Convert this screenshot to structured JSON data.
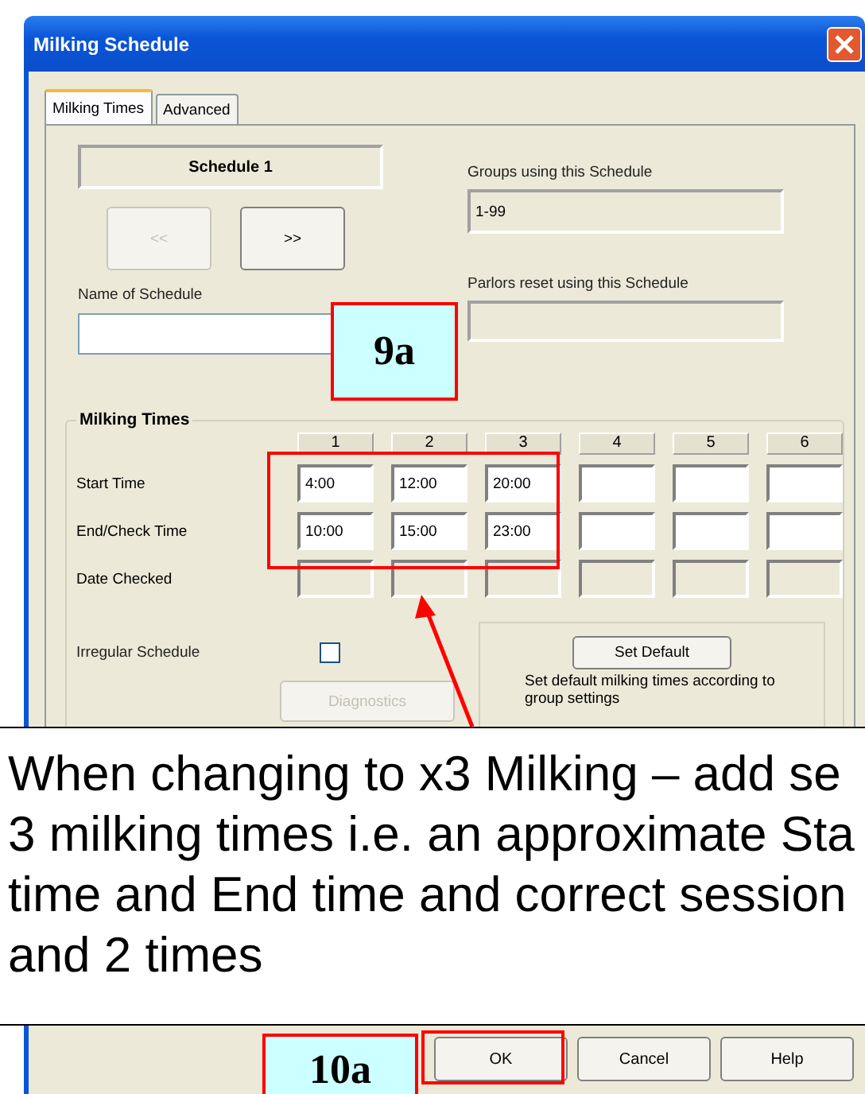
{
  "window": {
    "title": "Milking Schedule"
  },
  "tabs": [
    {
      "label": "Milking Times",
      "selected": true
    },
    {
      "label": "Advanced",
      "selected": false
    }
  ],
  "schedule": {
    "name_display": "Schedule 1",
    "prev_button": {
      "label": "<<",
      "disabled": true
    },
    "next_button": {
      "label": ">>",
      "disabled": false
    },
    "name_label": "Name of Schedule"
  },
  "groups": {
    "label": "Groups using this Schedule",
    "value": "1-99"
  },
  "parlors": {
    "label": "Parlors reset using this Schedule"
  },
  "milking_times": {
    "title": "Milking Times",
    "columns": [
      "1",
      "2",
      "3",
      "4",
      "5",
      "6"
    ],
    "rows": [
      {
        "label": "Start Time",
        "disabled": false,
        "cells": [
          "4:00",
          "12:00",
          "20:00"
        ]
      },
      {
        "label": "End/Check Time",
        "disabled": false,
        "cells": [
          "10:00",
          "15:00",
          "23:00"
        ]
      },
      {
        "label": "Date Checked",
        "disabled": true
      }
    ]
  },
  "irregular": {
    "label": "Irregular Schedule",
    "checked": false
  },
  "diagnostics_button": {
    "label": "Diagnostics",
    "disabled": true
  },
  "set_default": {
    "button": "Set Default",
    "description": "Set default milking times according to group settings"
  },
  "buttons": [
    {
      "label": "OK"
    },
    {
      "label": "Cancel"
    },
    {
      "label": "Help"
    }
  ],
  "annotations": {
    "callouts": [
      "9a",
      "10a"
    ],
    "note_lines": [
      "When changing to x3 Milking – add se",
      "3 milking times i.e. an approximate Sta",
      "time and End time and correct session",
      "and 2 times"
    ]
  }
}
